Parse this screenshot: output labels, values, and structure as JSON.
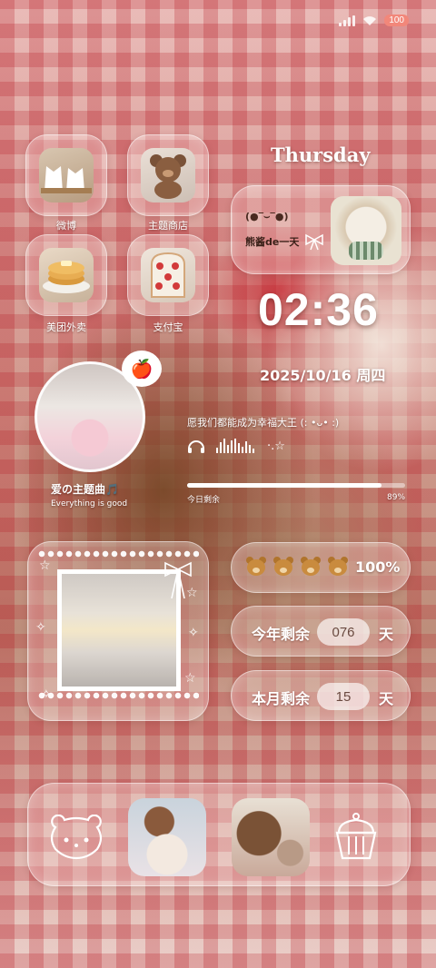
{
  "status": {
    "battery": "100"
  },
  "apps": [
    {
      "label": "微博",
      "icon": "cat-bread-icon"
    },
    {
      "label": "主题商店",
      "icon": "teddy-bear-icon"
    },
    {
      "label": "美团外卖",
      "icon": "pancake-icon"
    },
    {
      "label": "支付宝",
      "icon": "strawberry-toast-icon"
    }
  ],
  "widget_day": {
    "weekday": "Thursday",
    "kaomoji": "(●‾⌣‾●)",
    "name": "熊酱de一天"
  },
  "clock": {
    "time": "02:36",
    "date": "2025/10/16  周四"
  },
  "music": {
    "title": "爱の主题曲🎵",
    "subtitle": "Everything is good",
    "wish": "愿我们都能成为幸福大王 (: •ᴗ• :)",
    "deco": "·.☆"
  },
  "progress": {
    "label": "今日剩余",
    "percent_text": "89%",
    "fraction": 0.89
  },
  "counters": {
    "bears_pct": "100%",
    "year_label": "今年剩余",
    "year_value": "076",
    "year_unit": "天",
    "month_label": "本月剩余",
    "month_value": "15",
    "month_unit": "天"
  },
  "colors": {
    "battery": "#f2877a",
    "accent_red": "#d2232a"
  }
}
